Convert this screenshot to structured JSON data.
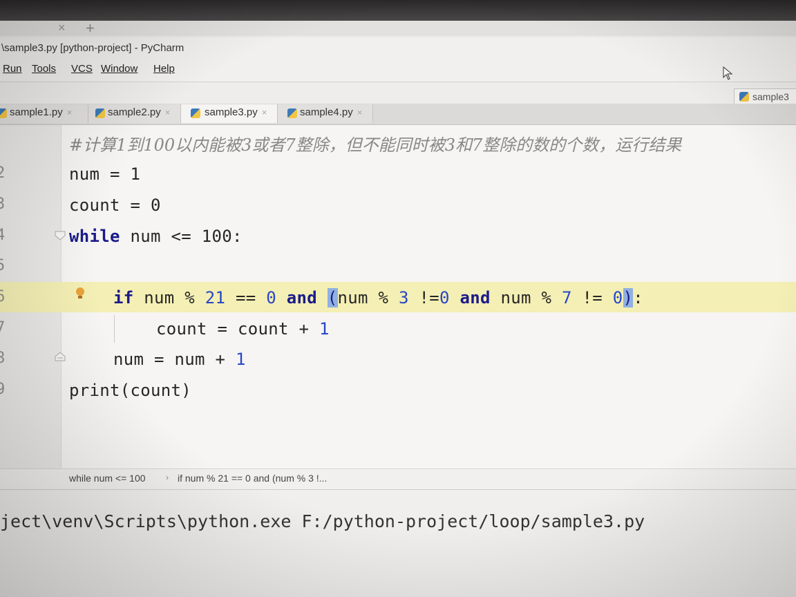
{
  "window": {
    "title": "\\sample3.py [python-project] - PyCharm"
  },
  "browser": {
    "close_glyph": "×",
    "new_tab_glyph": "+"
  },
  "menu": [
    {
      "label": "Run",
      "mnemonic": "u"
    },
    {
      "label": "Tools"
    },
    {
      "label": "VCS"
    },
    {
      "label": "Window"
    },
    {
      "label": "Help"
    }
  ],
  "run_config": {
    "label": "sample3"
  },
  "tabs": [
    {
      "label": "sample1.py",
      "active": false
    },
    {
      "label": "sample2.py",
      "active": false
    },
    {
      "label": "sample3.py",
      "active": true
    },
    {
      "label": "sample4.py",
      "active": false
    }
  ],
  "tab_close_glyph": "×",
  "editor": {
    "comment": "#计算1到100以内能被3或者7整除，但不能同时被3和7整除的数的个数，运行结果",
    "line_numbers": [
      "2",
      "3",
      "4",
      "5",
      "6",
      "7",
      "8",
      "9"
    ],
    "lines": {
      "l2": "num = 1",
      "l3": "count = 0",
      "l4_kw": "while",
      "l4_rest": " num <= 100:",
      "l6_if": "if",
      "l6_a": " num % ",
      "l6_n21": "21",
      "l6_b": " == ",
      "l6_n0": "0",
      "l6_and1": " and ",
      "l6_open": "(",
      "l6_c": "num % ",
      "l6_n3": "3",
      "l6_d": " !=",
      "l6_n0b": "0",
      "l6_and2": " and ",
      "l6_e": "num % ",
      "l6_n7": "7",
      "l6_f": " != ",
      "l6_n0c": "0",
      "l6_close": ")",
      "l6_colon": ":",
      "l7": "count = count + ",
      "l7_n": "1",
      "l8": "num = num + ",
      "l8_n": "1",
      "l9": "print(count)"
    },
    "highlight_color": "#f4efb4"
  },
  "breadcrumb": {
    "item1": "while num <= 100",
    "separator": "›",
    "item2": "if num % 21 == 0 and (num % 3 !..."
  },
  "run_output": {
    "line": "ject\\venv\\Scripts\\python.exe F:/python-project/loop/sample3.py"
  }
}
